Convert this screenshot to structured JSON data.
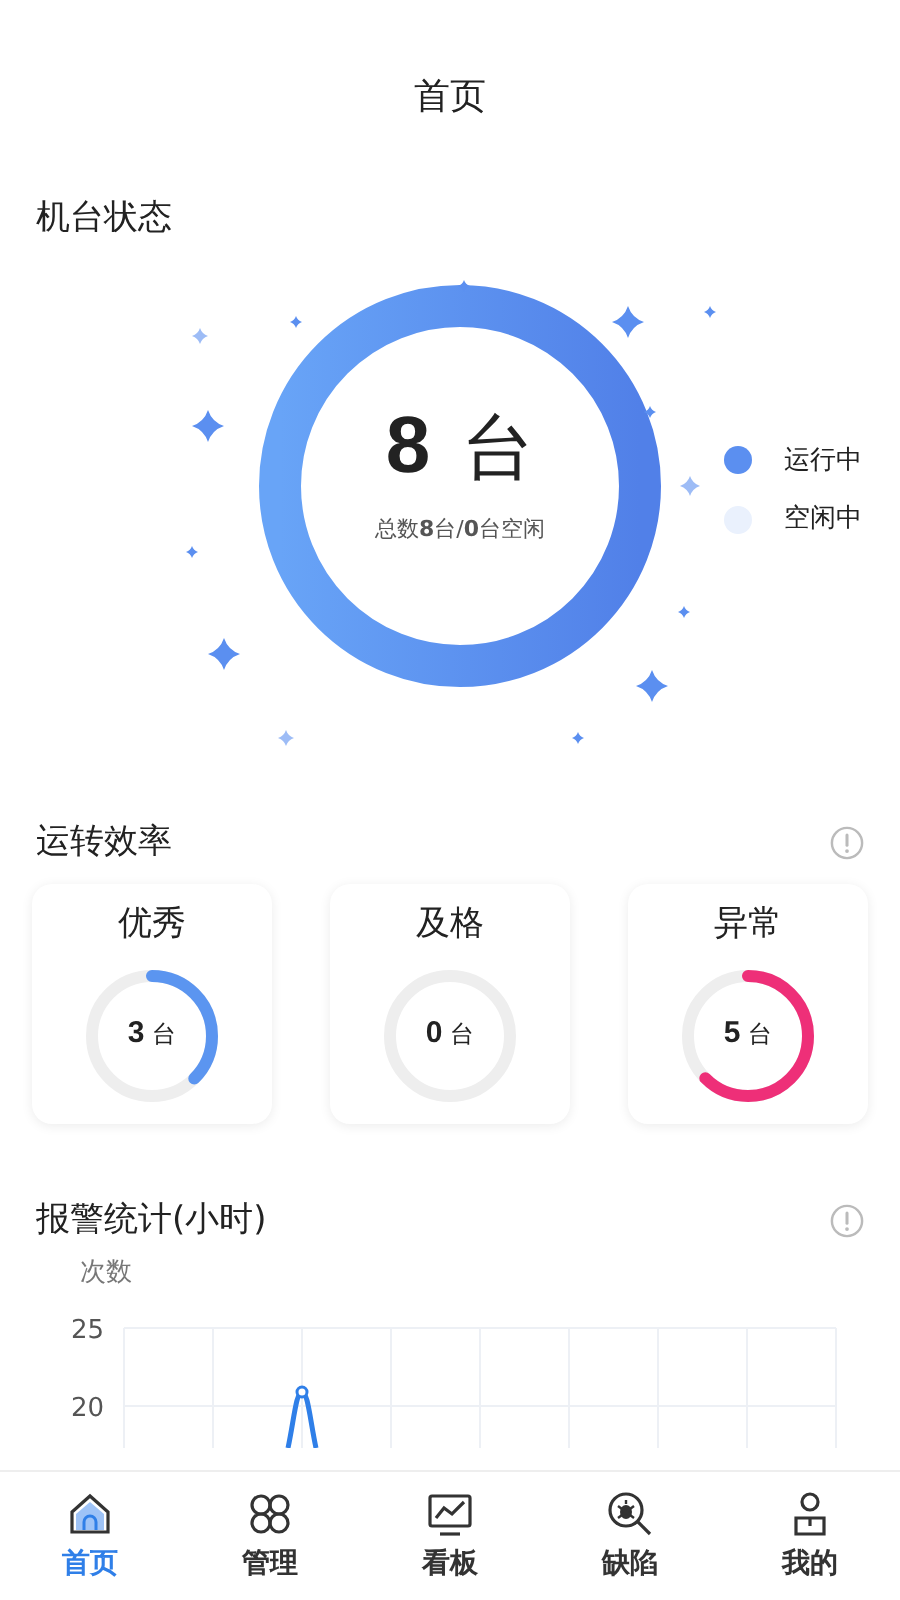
{
  "header": {
    "title": "首页"
  },
  "machine_status": {
    "title": "机台状态",
    "count": "8",
    "unit": "台",
    "summary": "总数**8**台/**0**台空闲",
    "legend": [
      {
        "label": "运行中",
        "color": "#5b8ff0"
      },
      {
        "label": "空闲中",
        "color": "#eaf1fd"
      }
    ]
  },
  "efficiency": {
    "title": "运转效率",
    "cards": [
      {
        "label": "优秀",
        "count": "3",
        "unit": "台",
        "level": 0.375,
        "color": "#5b95f0"
      },
      {
        "label": "及格",
        "count": "0",
        "unit": "台"
      },
      {
        "label": "异常",
        "count": "5",
        "unit": "台",
        "level": 0.625,
        "color": "#ee2f78"
      }
    ]
  },
  "alarms": {
    "title": "报警统计(小时)",
    "axis_title": "次数",
    "y_labels": [
      "25",
      "20"
    ]
  },
  "tabs": [
    {
      "label": "首页",
      "selected": true
    },
    {
      "label": "管理",
      "selected": false
    },
    {
      "label": "看板",
      "selected": false
    },
    {
      "label": "缺陷",
      "selected": false
    },
    {
      "label": "我的",
      "selected": false
    }
  ]
}
